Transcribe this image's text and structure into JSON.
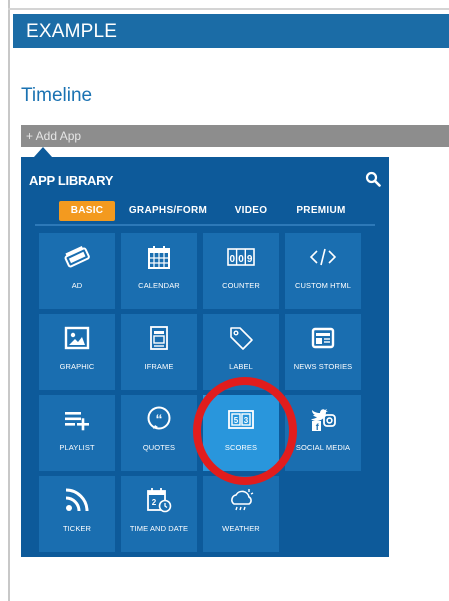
{
  "header": {
    "title": "EXAMPLE"
  },
  "section": {
    "title": "Timeline"
  },
  "add_app": {
    "label": "+ Add App"
  },
  "library": {
    "title": "APP LIBRARY",
    "tabs": [
      {
        "label": "BASIC",
        "active": true
      },
      {
        "label": "GRAPHS/FORM",
        "active": false
      },
      {
        "label": "VIDEO",
        "active": false
      },
      {
        "label": "PREMIUM",
        "active": false
      }
    ],
    "apps": [
      {
        "label": "AD",
        "icon": "ad-icon"
      },
      {
        "label": "CALENDAR",
        "icon": "calendar-icon"
      },
      {
        "label": "COUNTER",
        "icon": "counter-icon"
      },
      {
        "label": "CUSTOM HTML",
        "icon": "code-icon"
      },
      {
        "label": "GRAPHIC",
        "icon": "graphic-icon"
      },
      {
        "label": "IFRAME",
        "icon": "iframe-icon"
      },
      {
        "label": "LABEL",
        "icon": "tag-icon"
      },
      {
        "label": "NEWS STORIES",
        "icon": "news-icon"
      },
      {
        "label": "PLAYLIST",
        "icon": "playlist-icon"
      },
      {
        "label": "QUOTES",
        "icon": "quotes-icon"
      },
      {
        "label": "SCORES",
        "icon": "scoreboard-icon",
        "selected": true
      },
      {
        "label": "SOCIAL MEDIA",
        "icon": "social-media-icon"
      },
      {
        "label": "TICKER",
        "icon": "rss-icon"
      },
      {
        "label": "TIME AND DATE",
        "icon": "clock-calendar-icon"
      },
      {
        "label": "WEATHER",
        "icon": "weather-icon"
      }
    ]
  },
  "colors": {
    "header_bg": "#1b6ca6",
    "library_bg": "#0d5a9a",
    "tile_bg": "#1a6eb0",
    "tile_selected_bg": "#2996dc",
    "tab_active_bg": "#f39a1f",
    "highlight_ring": "#e11d1d"
  }
}
